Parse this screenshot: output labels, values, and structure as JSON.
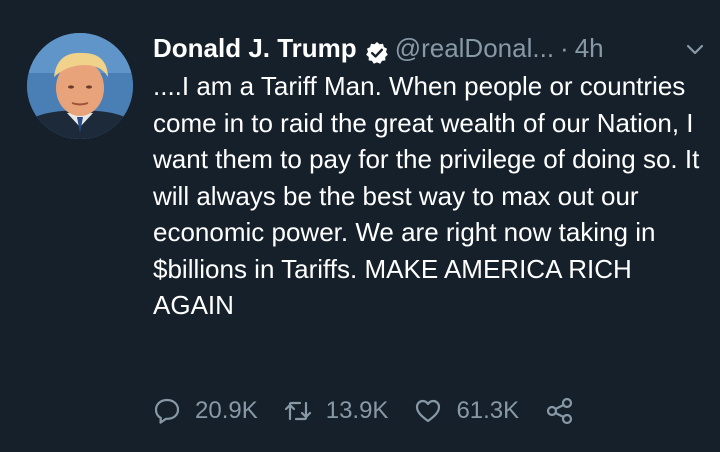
{
  "tweet": {
    "author_name": "Donald J. Trump",
    "handle": "@realDonal...",
    "separator": "·",
    "time": "4h",
    "text": "....I am a Tariff Man. When people or countries come in to raid the great wealth of our Nation, I want them to pay for the privilege of doing so. It will always be the best way to max out our economic power. We are right now taking in $billions in Tariffs. MAKE AMERICA RICH AGAIN"
  },
  "stats": {
    "replies": "20.9K",
    "retweets": "13.9K",
    "likes": "61.3K"
  },
  "icons": {
    "verified": "verified-badge-icon",
    "menu": "chevron-down-icon",
    "reply": "reply-icon",
    "retweet": "retweet-icon",
    "like": "heart-icon",
    "share": "share-icon"
  },
  "colors": {
    "background": "#15202b",
    "text": "#ffffff",
    "muted": "#8899a6"
  }
}
